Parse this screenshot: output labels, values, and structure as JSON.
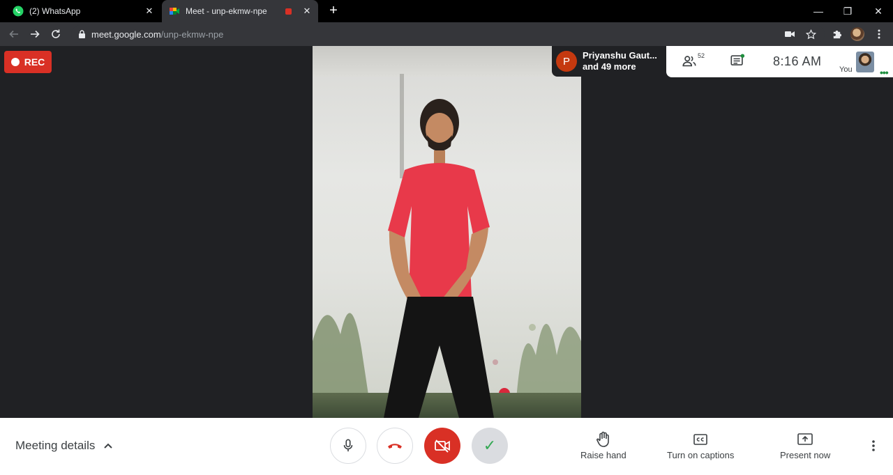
{
  "browser": {
    "tabs": [
      {
        "title": "(2) WhatsApp",
        "icon": "whatsapp-icon",
        "active": false
      },
      {
        "title": "Meet - unp-ekmw-npe",
        "icon": "google-meet-icon",
        "active": true,
        "recording": true
      }
    ],
    "close_glyph": "✕",
    "new_tab_glyph": "+",
    "window_controls": {
      "minimize": "—",
      "restore": "❐",
      "close": "✕"
    },
    "url": {
      "host": "meet.google.com",
      "path": "/unp-ekmw-npe"
    }
  },
  "meeting": {
    "rec_label": "REC",
    "participants": {
      "avatar_letter": "P",
      "line1": "Priyanshu Gaut...",
      "line2": "and 49 more"
    },
    "people_count": "52",
    "time": "8:16  AM",
    "self_label": "You",
    "more_glyph": "•••"
  },
  "controls": {
    "meeting_details": "Meeting details",
    "check_glyph": "✓",
    "actions": [
      {
        "label": "Raise hand",
        "icon": "raise-hand-icon"
      },
      {
        "label": "Turn on captions",
        "icon": "captions-icon"
      },
      {
        "label": "Present now",
        "icon": "present-icon"
      }
    ]
  },
  "colors": {
    "accent_red": "#d93025",
    "chrome_dark": "#35363a",
    "stage_bg": "#202124",
    "shirt_red": "#e8394a"
  }
}
